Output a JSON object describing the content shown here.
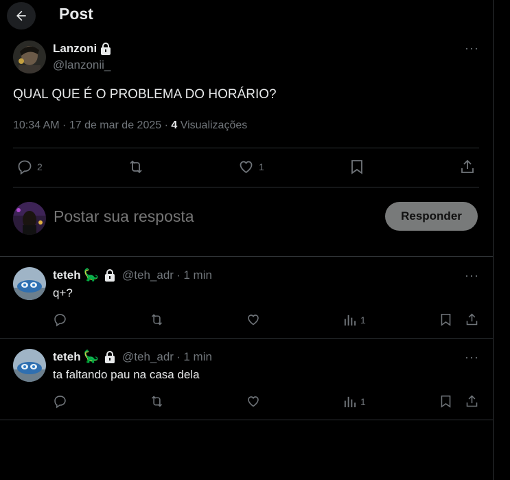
{
  "header": {
    "title": "Post"
  },
  "post": {
    "author_name": "Lanzoni",
    "author_handle": "@lanzonii_",
    "text": "QUAL QUE É O PROBLEMA DO HORÁRIO?",
    "timestamp": "10:34 AM · 17 de mar de 2025 · ",
    "views_count": "4",
    "views_label": " Visualizações",
    "reply_count": "2",
    "like_count": "1",
    "more_label": "···"
  },
  "composer": {
    "placeholder": "Postar sua resposta",
    "button_label": "Responder"
  },
  "replies": [
    {
      "name": "teteh",
      "emoji": "🦕",
      "handle": "@teh_adr",
      "time": "· 1 min",
      "text": "q+?",
      "views": "1",
      "more_label": "···"
    },
    {
      "name": "teteh",
      "emoji": "🦕",
      "handle": "@teh_adr",
      "time": "· 1 min",
      "text": "ta faltando pau na casa dela",
      "views": "1",
      "more_label": "···"
    }
  ],
  "colors": {
    "background": "#000000",
    "text": "#e7e9ea",
    "muted": "#71767b",
    "border": "#2f3336",
    "button": "#787a7a"
  }
}
